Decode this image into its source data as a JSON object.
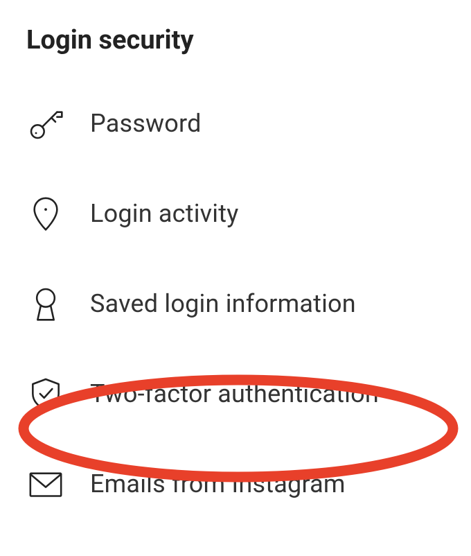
{
  "section": {
    "title": "Login security",
    "items": [
      {
        "label": "Password"
      },
      {
        "label": "Login activity"
      },
      {
        "label": "Saved login information"
      },
      {
        "label": "Two-factor authentication"
      },
      {
        "label": "Emails from Instagram"
      }
    ]
  },
  "annotation": {
    "highlighted_index": 3,
    "color": "#e8402a"
  }
}
